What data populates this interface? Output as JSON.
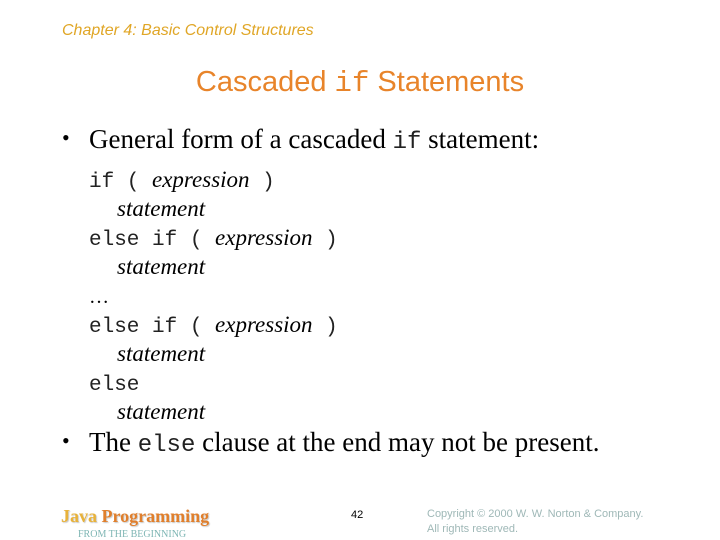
{
  "header": {
    "chapter": "Chapter 4: Basic Control Structures",
    "title_prefix": "Cascaded ",
    "title_code": "if",
    "title_suffix": " Statements"
  },
  "bullets": [
    {
      "marker": "•",
      "text_before": "General form of a cascaded ",
      "code": "if",
      "text_after": " statement:"
    },
    {
      "marker": "•",
      "text_before": "The ",
      "code": "else",
      "text_after": " clause at the end may not be present."
    }
  ],
  "code_form": {
    "line1": {
      "kw1": "if ( ",
      "it": "expression",
      "kw2": " )"
    },
    "line2": {
      "it": "statement"
    },
    "line3": {
      "kw1": "else if ( ",
      "it": "expression",
      "kw2": " )"
    },
    "line4": {
      "it": "statement"
    },
    "line5": {
      "text": "…"
    },
    "line6": {
      "kw1": "else if ( ",
      "it": "expression",
      "kw2": " )"
    },
    "line7": {
      "it": "statement"
    },
    "line8": {
      "kw1": "else"
    },
    "line9": {
      "it": "statement"
    }
  },
  "footer": {
    "brand_java": "Java ",
    "brand_programming": "Programming",
    "brand_sub": "FROM THE BEGINNING",
    "page_number": "42",
    "copyright_line1": "Copyright © 2000 W. W. Norton & Company.",
    "copyright_line2": "All rights reserved."
  },
  "colors": {
    "chapter": "#e0a626",
    "title": "#e8842a",
    "brand_java": "#e8b23a",
    "brand_programming": "#e07f2c",
    "brand_sub": "#7fb6b4",
    "copyright": "#9fb8b7"
  }
}
